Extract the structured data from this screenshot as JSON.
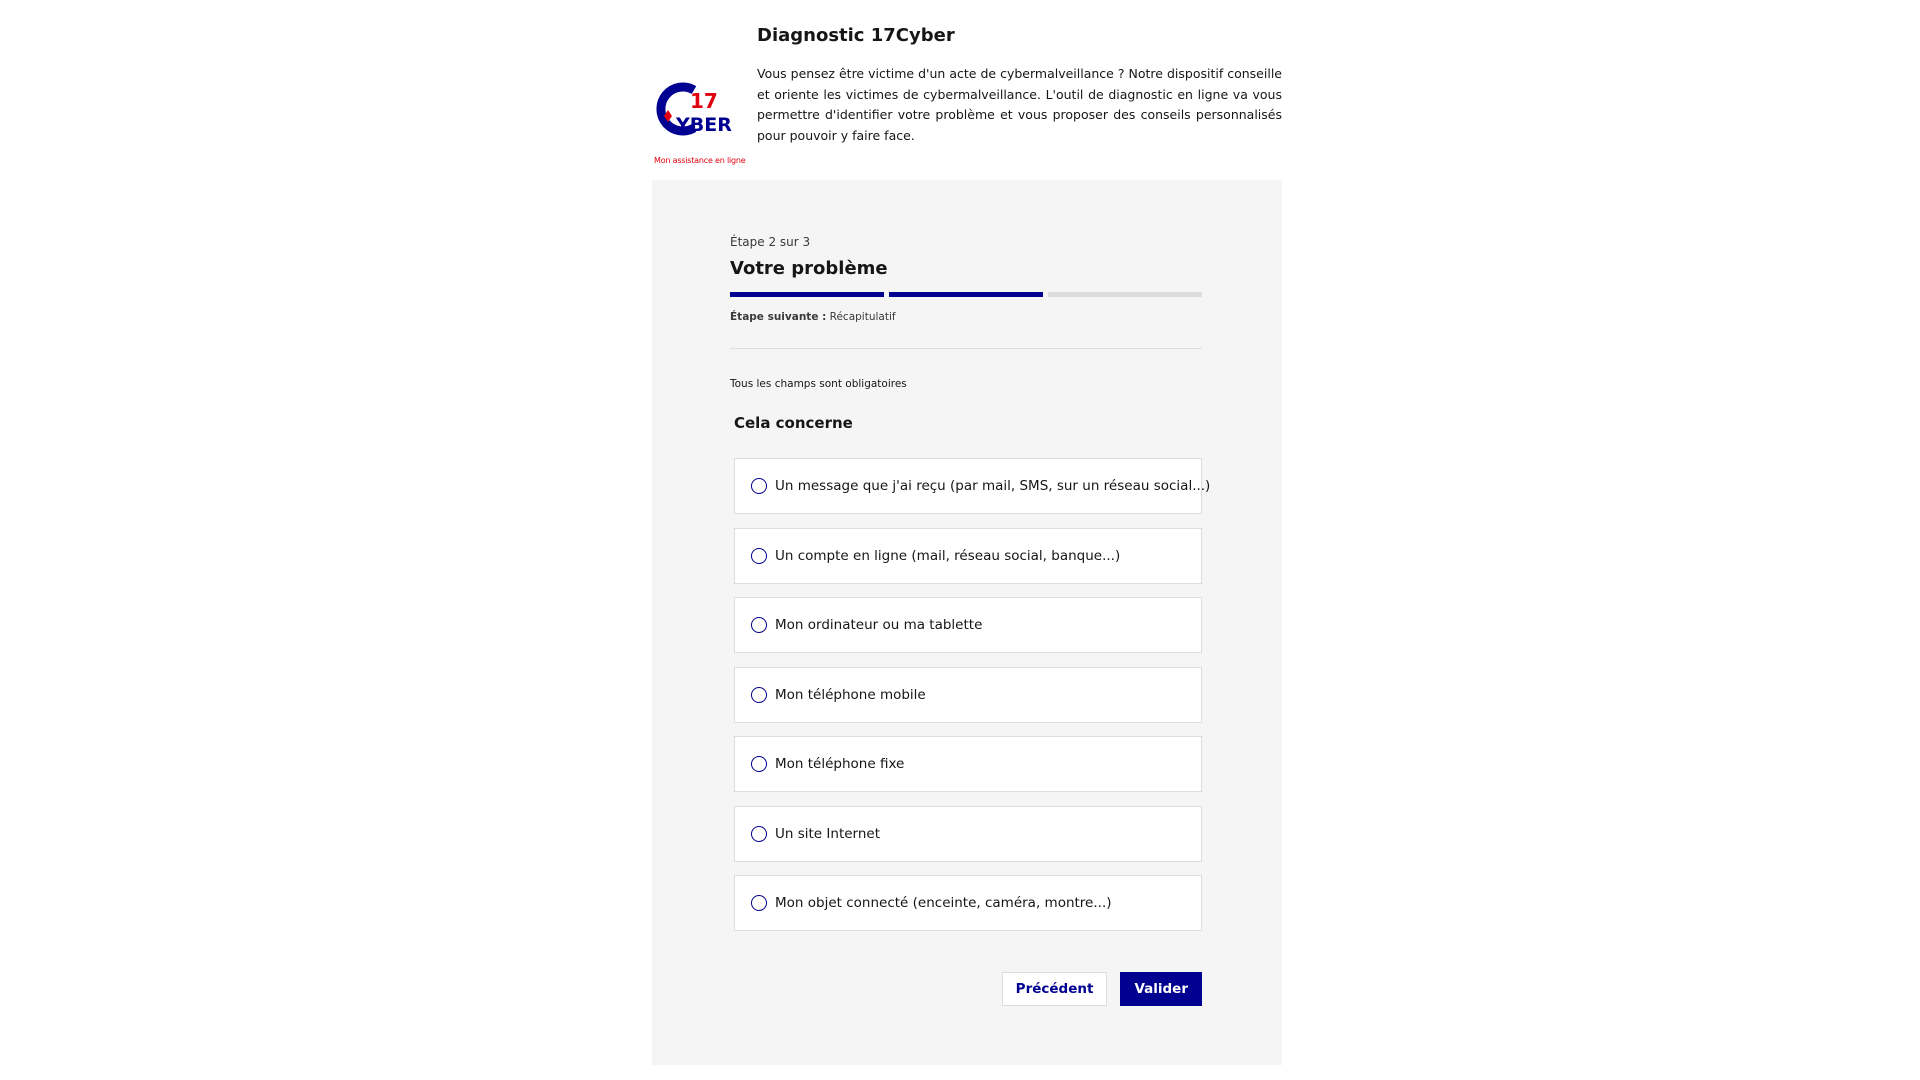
{
  "logo": {
    "number": "17",
    "word": "YBER",
    "tagline": "Mon assistance en ligne"
  },
  "intro": {
    "title": "Diagnostic 17Cyber",
    "text": "Vous pensez être victime d'un acte de cybermalveillance ? Notre dispositif conseille et oriente les victimes de cybermalveillance. L'outil de diagnostic en ligne va vous permettre d'identifier votre problème et vous proposer des conseils personnalisés pour pouvoir y faire face."
  },
  "stepper": {
    "step_count": "Étape 2 sur 3",
    "title": "Votre problème",
    "progress": {
      "current": 2,
      "total": 3
    },
    "next_label": "Étape suivante :",
    "next_value": "Récapitulatif"
  },
  "form": {
    "required_note": "Tous les champs sont obligatoires",
    "legend": "Cela concerne",
    "options": [
      "Un message que j'ai reçu (par mail, SMS, sur un réseau social...)",
      "Un compte en ligne (mail, réseau social, banque...)",
      "Mon ordinateur ou ma tablette",
      "Mon téléphone mobile",
      "Mon téléphone fixe",
      "Un site Internet",
      "Mon objet connecté (enceinte, caméra, montre...)"
    ]
  },
  "buttons": {
    "previous": "Précédent",
    "submit": "Valider"
  },
  "colors": {
    "primary": "#000091",
    "accent": "#e1000f",
    "panel_bg": "#f5f5f5"
  }
}
